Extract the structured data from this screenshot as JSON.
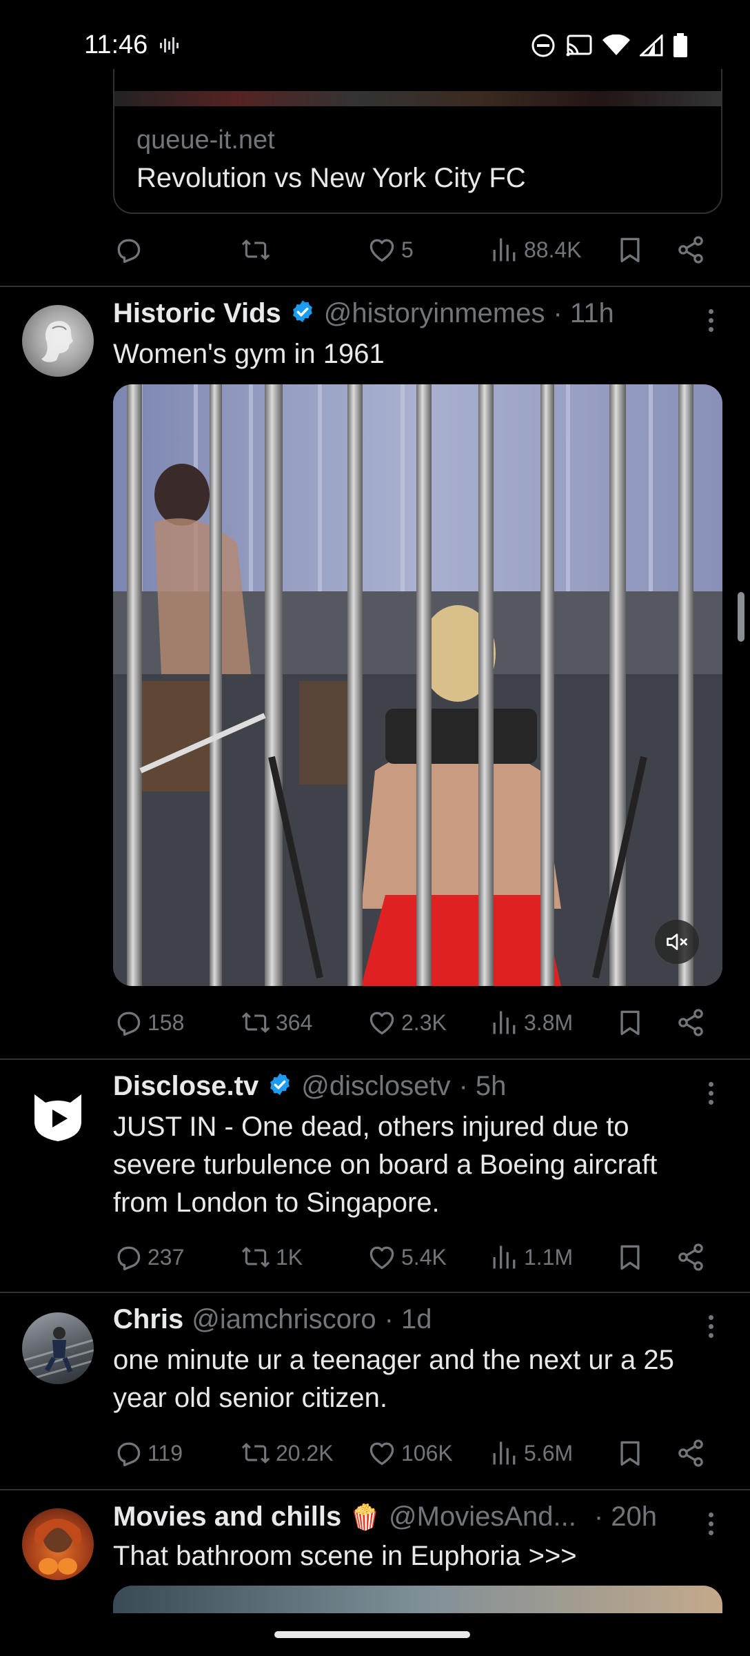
{
  "status_bar": {
    "time": "11:46",
    "left_icons": [
      "voicemail-wave-icon"
    ],
    "right_icons": [
      "do-not-disturb-icon",
      "cast-icon",
      "wifi-icon",
      "signal-icon",
      "battery-icon"
    ]
  },
  "prev_tweet": {
    "card": {
      "domain": "queue-it.net",
      "title": "Revolution vs New York City FC"
    },
    "actions": {
      "replies": "",
      "reposts": "",
      "likes": "5",
      "views": "88.4K"
    }
  },
  "tweets": [
    {
      "name": "Historic Vids",
      "verified": true,
      "handle": "@historyinmemes",
      "time": "· 11h",
      "text": "Women's gym in 1961",
      "media": "video",
      "actions": {
        "replies": "158",
        "reposts": "364",
        "likes": "2.3K",
        "views": "3.8M"
      }
    },
    {
      "name": "Disclose.tv",
      "verified": true,
      "handle": "@disclosetv",
      "time": "· 5h",
      "text_lines": [
        "JUST IN - One dead, others injured due to",
        "severe turbulence on board a Boeing aircraft",
        "from London to Singapore."
      ],
      "actions": {
        "replies": "237",
        "reposts": "1K",
        "likes": "5.4K",
        "views": "1.1M"
      }
    },
    {
      "name": "Chris",
      "verified": false,
      "handle": "@iamchriscoro",
      "time": "· 1d",
      "text_lines": [
        "one minute ur a teenager and the next ur a 25",
        "year old senior citizen."
      ],
      "actions": {
        "replies": "119",
        "reposts": "20.2K",
        "likes": "106K",
        "views": "5.6M"
      }
    },
    {
      "name": "Movies and chills",
      "emoji": "🍿",
      "verified": false,
      "handle": "@MoviesAnd...",
      "time": "· 20h",
      "text": "That bathroom scene in Euphoria >>>"
    }
  ],
  "colors": {
    "background": "#000000",
    "text": "#e7e9ea",
    "muted": "#71767b",
    "divider": "#2f3336",
    "verified": "#1d9bf0"
  }
}
